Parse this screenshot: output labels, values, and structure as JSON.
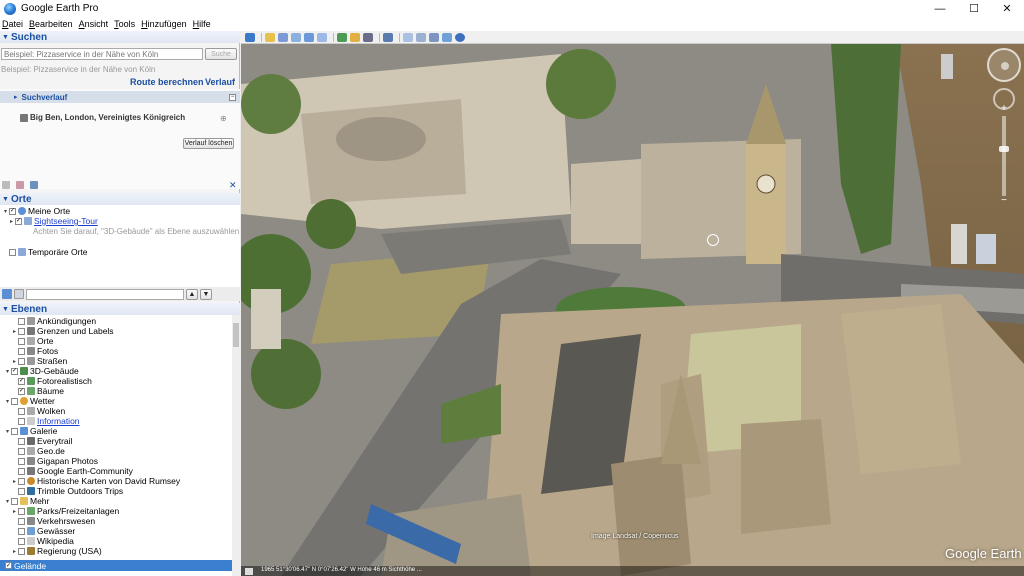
{
  "window": {
    "title": "Google Earth Pro",
    "minimize": "—",
    "maximize": "☐",
    "close": "✕"
  },
  "menu": [
    "Datei",
    "Bearbeiten",
    "Ansicht",
    "Tools",
    "Hinzufügen",
    "Hilfe"
  ],
  "search": {
    "header": "Suchen",
    "placeholder": "Beispiel: Pizzaservice in der Nähe von Köln",
    "button": "Suche",
    "route_link": "Route berechnen",
    "history_link": "Verlauf",
    "history_header": "Suchverlauf",
    "history_item": "Big Ben, London, Vereinigtes Königreich",
    "clear_button": "Verlauf löschen"
  },
  "places": {
    "header": "Orte",
    "items": [
      {
        "label": "Meine Orte"
      },
      {
        "label": "Sightseeing-Tour",
        "note": "Achten Sie darauf, \"3D-Gebäude\" als Ebene auszuwählen"
      },
      {
        "label": "Temporäre Orte"
      }
    ]
  },
  "layers": {
    "header": "Ebenen",
    "items": [
      "Ankündigungen",
      "Grenzen und Labels",
      "Orte",
      "Fotos",
      "Straßen",
      "3D-Gebäude",
      "Fotorealistisch",
      "Bäume",
      "Wetter",
      "Wolken",
      "Information",
      "Galerie",
      "Everytrail",
      "Geo.de",
      "Gigapan Photos",
      "Google Earth-Community",
      "Historische Karten von David Rumsey",
      "Trimble Outdoors Trips",
      "Mehr",
      "Parks/Freizeitanlagen",
      "Verkehrswesen",
      "Gewässer",
      "Wikipedia",
      "Regierung (USA)",
      "Gelände"
    ]
  },
  "map": {
    "logo": "Google Earth",
    "image_label": "Image Landsat / Copernicus",
    "status": "1965   51°30'06.47\" N  0°07'26.42\" W Höhe  46 m   Sichthöhe  ..."
  }
}
